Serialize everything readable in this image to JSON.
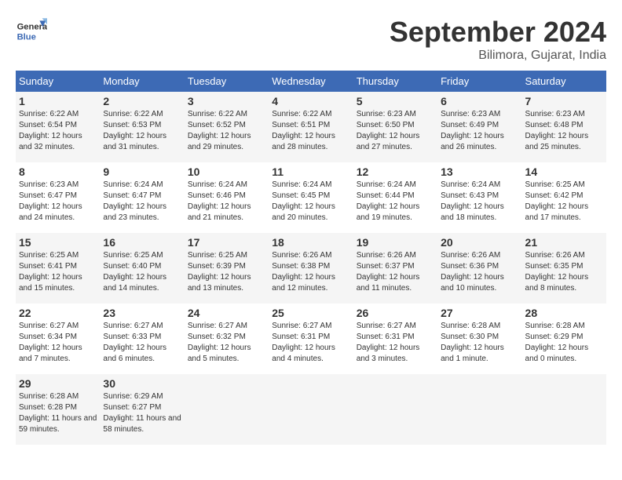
{
  "header": {
    "logo_text_general": "General",
    "logo_text_blue": "Blue",
    "month": "September 2024",
    "location": "Bilimora, Gujarat, India"
  },
  "weekdays": [
    "Sunday",
    "Monday",
    "Tuesday",
    "Wednesday",
    "Thursday",
    "Friday",
    "Saturday"
  ],
  "weeks": [
    [
      {
        "day": "1",
        "sunrise": "6:22 AM",
        "sunset": "6:54 PM",
        "daylight": "12 hours and 32 minutes."
      },
      {
        "day": "2",
        "sunrise": "6:22 AM",
        "sunset": "6:53 PM",
        "daylight": "12 hours and 31 minutes."
      },
      {
        "day": "3",
        "sunrise": "6:22 AM",
        "sunset": "6:52 PM",
        "daylight": "12 hours and 29 minutes."
      },
      {
        "day": "4",
        "sunrise": "6:22 AM",
        "sunset": "6:51 PM",
        "daylight": "12 hours and 28 minutes."
      },
      {
        "day": "5",
        "sunrise": "6:23 AM",
        "sunset": "6:50 PM",
        "daylight": "12 hours and 27 minutes."
      },
      {
        "day": "6",
        "sunrise": "6:23 AM",
        "sunset": "6:49 PM",
        "daylight": "12 hours and 26 minutes."
      },
      {
        "day": "7",
        "sunrise": "6:23 AM",
        "sunset": "6:48 PM",
        "daylight": "12 hours and 25 minutes."
      }
    ],
    [
      {
        "day": "8",
        "sunrise": "6:23 AM",
        "sunset": "6:47 PM",
        "daylight": "12 hours and 24 minutes."
      },
      {
        "day": "9",
        "sunrise": "6:24 AM",
        "sunset": "6:47 PM",
        "daylight": "12 hours and 23 minutes."
      },
      {
        "day": "10",
        "sunrise": "6:24 AM",
        "sunset": "6:46 PM",
        "daylight": "12 hours and 21 minutes."
      },
      {
        "day": "11",
        "sunrise": "6:24 AM",
        "sunset": "6:45 PM",
        "daylight": "12 hours and 20 minutes."
      },
      {
        "day": "12",
        "sunrise": "6:24 AM",
        "sunset": "6:44 PM",
        "daylight": "12 hours and 19 minutes."
      },
      {
        "day": "13",
        "sunrise": "6:24 AM",
        "sunset": "6:43 PM",
        "daylight": "12 hours and 18 minutes."
      },
      {
        "day": "14",
        "sunrise": "6:25 AM",
        "sunset": "6:42 PM",
        "daylight": "12 hours and 17 minutes."
      }
    ],
    [
      {
        "day": "15",
        "sunrise": "6:25 AM",
        "sunset": "6:41 PM",
        "daylight": "12 hours and 15 minutes."
      },
      {
        "day": "16",
        "sunrise": "6:25 AM",
        "sunset": "6:40 PM",
        "daylight": "12 hours and 14 minutes."
      },
      {
        "day": "17",
        "sunrise": "6:25 AM",
        "sunset": "6:39 PM",
        "daylight": "12 hours and 13 minutes."
      },
      {
        "day": "18",
        "sunrise": "6:26 AM",
        "sunset": "6:38 PM",
        "daylight": "12 hours and 12 minutes."
      },
      {
        "day": "19",
        "sunrise": "6:26 AM",
        "sunset": "6:37 PM",
        "daylight": "12 hours and 11 minutes."
      },
      {
        "day": "20",
        "sunrise": "6:26 AM",
        "sunset": "6:36 PM",
        "daylight": "12 hours and 10 minutes."
      },
      {
        "day": "21",
        "sunrise": "6:26 AM",
        "sunset": "6:35 PM",
        "daylight": "12 hours and 8 minutes."
      }
    ],
    [
      {
        "day": "22",
        "sunrise": "6:27 AM",
        "sunset": "6:34 PM",
        "daylight": "12 hours and 7 minutes."
      },
      {
        "day": "23",
        "sunrise": "6:27 AM",
        "sunset": "6:33 PM",
        "daylight": "12 hours and 6 minutes."
      },
      {
        "day": "24",
        "sunrise": "6:27 AM",
        "sunset": "6:32 PM",
        "daylight": "12 hours and 5 minutes."
      },
      {
        "day": "25",
        "sunrise": "6:27 AM",
        "sunset": "6:31 PM",
        "daylight": "12 hours and 4 minutes."
      },
      {
        "day": "26",
        "sunrise": "6:27 AM",
        "sunset": "6:31 PM",
        "daylight": "12 hours and 3 minutes."
      },
      {
        "day": "27",
        "sunrise": "6:28 AM",
        "sunset": "6:30 PM",
        "daylight": "12 hours and 1 minute."
      },
      {
        "day": "28",
        "sunrise": "6:28 AM",
        "sunset": "6:29 PM",
        "daylight": "12 hours and 0 minutes."
      }
    ],
    [
      {
        "day": "29",
        "sunrise": "6:28 AM",
        "sunset": "6:28 PM",
        "daylight": "11 hours and 59 minutes."
      },
      {
        "day": "30",
        "sunrise": "6:29 AM",
        "sunset": "6:27 PM",
        "daylight": "11 hours and 58 minutes."
      },
      null,
      null,
      null,
      null,
      null
    ]
  ]
}
